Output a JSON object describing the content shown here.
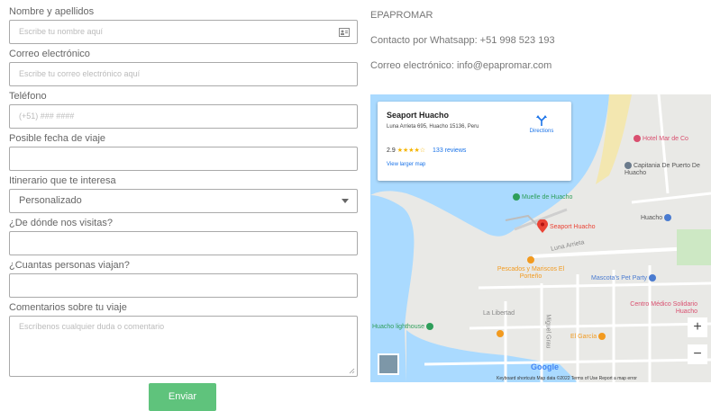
{
  "form": {
    "name_label": "Nombre y apellidos",
    "name_placeholder": "Escribe tu nombre aquí",
    "email_label": "Correo electrónico",
    "email_placeholder": "Escribe tu correo electrónico aquí",
    "phone_label": "Teléfono",
    "phone_placeholder": "(+51) ### ####",
    "date_label": "Posible fecha de viaje",
    "itinerary_label": "Itinerario que te interesa",
    "itinerary_value": "Personalizado",
    "origin_label": "¿De dónde nos visitas?",
    "people_label": "¿Cuantas personas viajan?",
    "comments_label": "Comentarios sobre tu viaje",
    "comments_placeholder": "Escríbenos cualquier duda o comentario",
    "submit_label": "Enviar"
  },
  "contact": {
    "company": "EPAPROMAR",
    "whatsapp": "Contacto por Whatsapp: +51 998 523 193",
    "email": "Correo electrónico: info@epapromar.com"
  },
  "map": {
    "place_name": "Seaport Huacho",
    "address": "Luna Arrieta 695, Huacho 15136, Peru",
    "rating": "2.9",
    "stars": "★★★★☆",
    "reviews": "133 reviews",
    "view_larger": "View larger map",
    "directions": "Directions",
    "pois": {
      "hotel": "Hotel Mar de Co",
      "capitania": "Capitania De Puerto De Huacho",
      "muelle": "Muelle de Huacho",
      "seaport": "Seaport Huacho",
      "huacho": "Huacho",
      "pescados": "Pescados y Mariscos El Porteño",
      "mascotas": "Mascota's Pet Party",
      "centro": "Centro Médico Solidario Huacho",
      "lighthouse": "Huacho lighthouse",
      "garcia": "El García",
      "street": "Luna Arrieta",
      "street2": "La Libertad",
      "street3": "Miguel Grau"
    },
    "zoom_in": "+",
    "zoom_out": "−",
    "google": "Google",
    "attribution": "Keyboard shortcuts   Map data ©2022   Terms of Use   Report a map error"
  },
  "colors": {
    "water": "#aadaff",
    "button": "#5fc37c",
    "pin": "#ea4335",
    "poi_green": "#2e9e5a",
    "poi_orange": "#f29a1f",
    "poi_blue": "#4a7bd0",
    "poi_pink": "#d94f6f"
  }
}
